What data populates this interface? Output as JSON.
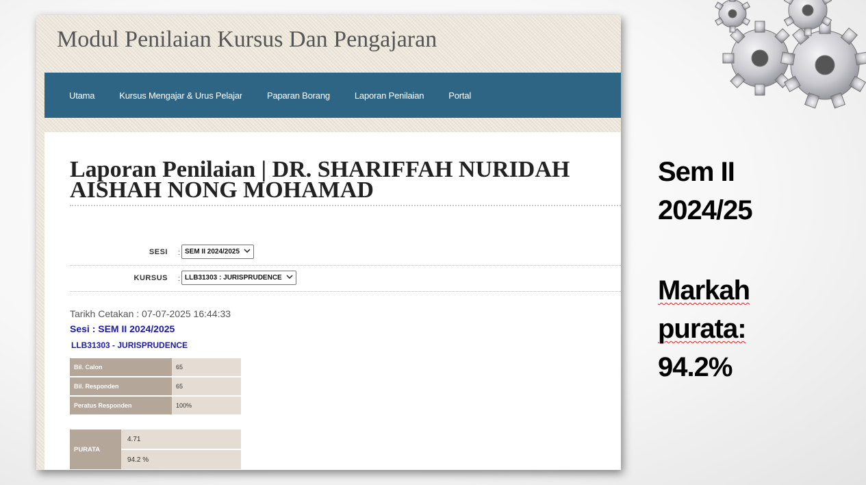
{
  "slide": {
    "sem_line1": "Sem II",
    "sem_line2": "2024/25",
    "markah_line1": "Markah",
    "markah_line2": "purata:",
    "markah_line3": "94.2%"
  },
  "site": {
    "title": "Modul Penilaian Kursus Dan Pengajaran"
  },
  "nav": {
    "items": [
      "Utama",
      "Kursus Mengajar & Urus Pelajar",
      "Paparan Borang",
      "Laporan Penilaian",
      "Portal"
    ]
  },
  "report": {
    "heading": "Laporan Penilaian | DR. SHARIFFAH NURIDAH AISHAH NONG MOHAMAD",
    "sesi_label": "SESI",
    "sesi_value": "SEM II 2024/2025",
    "kursus_label": "KURSUS",
    "kursus_value": "LLB31303 : JURISPRUDENCE",
    "colon": ":",
    "print_date": "Tarikh Cetakan : 07-07-2025 16:44:33",
    "sesi_heading": "Sesi : SEM II 2024/2025",
    "course_heading": "LLB31303 - JURISPRUDENCE",
    "stats": [
      {
        "label": "Bil. Calon",
        "value": "65"
      },
      {
        "label": "Bil. Responden",
        "value": "65"
      },
      {
        "label": "Peratus Responden",
        "value": "100%"
      }
    ],
    "purata": {
      "label": "PURATA",
      "score": "4.71",
      "percent": "94.2 %"
    }
  },
  "colors": {
    "navbar": "#2e6584",
    "table_label": "#b4a699",
    "table_value": "#e5ddd3",
    "heading_blue": "#1a1aa6"
  }
}
